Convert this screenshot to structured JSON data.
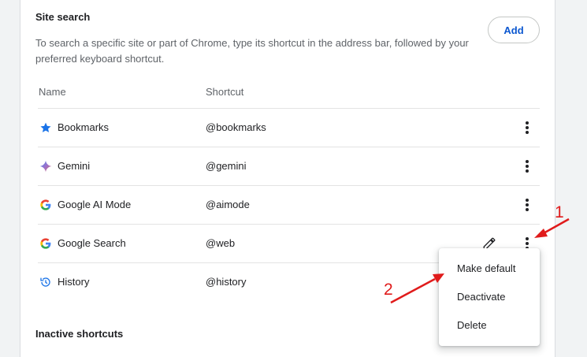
{
  "site_search": {
    "title": "Site search",
    "description": "To search a specific site or part of Chrome, type its shortcut in the address bar, followed by your preferred keyboard shortcut.",
    "add_label": "Add",
    "columns": {
      "name": "Name",
      "shortcut": "Shortcut"
    },
    "rows": [
      {
        "name": "Bookmarks",
        "shortcut": "@bookmarks",
        "icon": "star-icon"
      },
      {
        "name": "Gemini",
        "shortcut": "@gemini",
        "icon": "gemini-sparkle-icon"
      },
      {
        "name": "Google AI Mode",
        "shortcut": "@aimode",
        "icon": "google-g-icon"
      },
      {
        "name": "Google Search",
        "shortcut": "@web",
        "icon": "google-g-icon"
      },
      {
        "name": "History",
        "shortcut": "@history",
        "icon": "history-icon"
      }
    ]
  },
  "context_menu": {
    "items": [
      "Make default",
      "Deactivate",
      "Delete"
    ]
  },
  "inactive_shortcuts": {
    "title": "Inactive shortcuts"
  },
  "annotations": {
    "one": "1",
    "two": "2"
  },
  "colors": {
    "accent": "#0b57d0",
    "annotation": "#e01b1b",
    "star": "#1a73e8"
  }
}
